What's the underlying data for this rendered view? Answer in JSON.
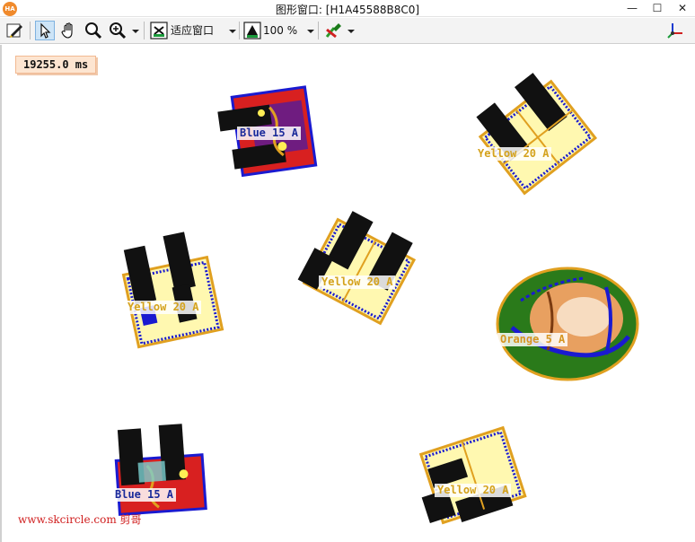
{
  "window": {
    "title": "图形窗口: [H1A45588B8C0]",
    "app_icon_text": "HA",
    "minimize_symbol": "—",
    "maximize_symbol": "☐",
    "close_symbol": "✕"
  },
  "toolbar": {
    "fit_window_label": "适应窗口",
    "zoom_value": "100 %",
    "icons": [
      "pencil-icon",
      "pointer-icon",
      "hand-icon",
      "magnifier-icon",
      "zoom-in-icon",
      "fit-window-icon",
      "zoom-percent-icon",
      "color-picker-icon",
      "axes-icon"
    ]
  },
  "canvas": {
    "timer_text": "19255.0 ms",
    "watermark": "www.skcircle.com 剪哥",
    "labels": [
      {
        "text": "Blue 15 A",
        "color": "blue"
      },
      {
        "text": "Yellow 20 A",
        "color": "yellow"
      },
      {
        "text": "Yellow 20 A",
        "color": "yellow"
      },
      {
        "text": "Yellow 20 A",
        "color": "yellow"
      },
      {
        "text": "Orange 5 A",
        "color": "orange"
      },
      {
        "text": "Blue 15 A",
        "color": "blue"
      },
      {
        "text": "Yellow 20 A",
        "color": "yellow"
      }
    ]
  },
  "colors": {
    "yellow_label": "#d4a21c",
    "blue_label": "#1a2a9a",
    "orange_label": "#d59522",
    "contour": "#e0a020",
    "region_blue": "#1a1ad0",
    "fuse_black": "#111111",
    "orange_green": "#2a7a1a"
  }
}
